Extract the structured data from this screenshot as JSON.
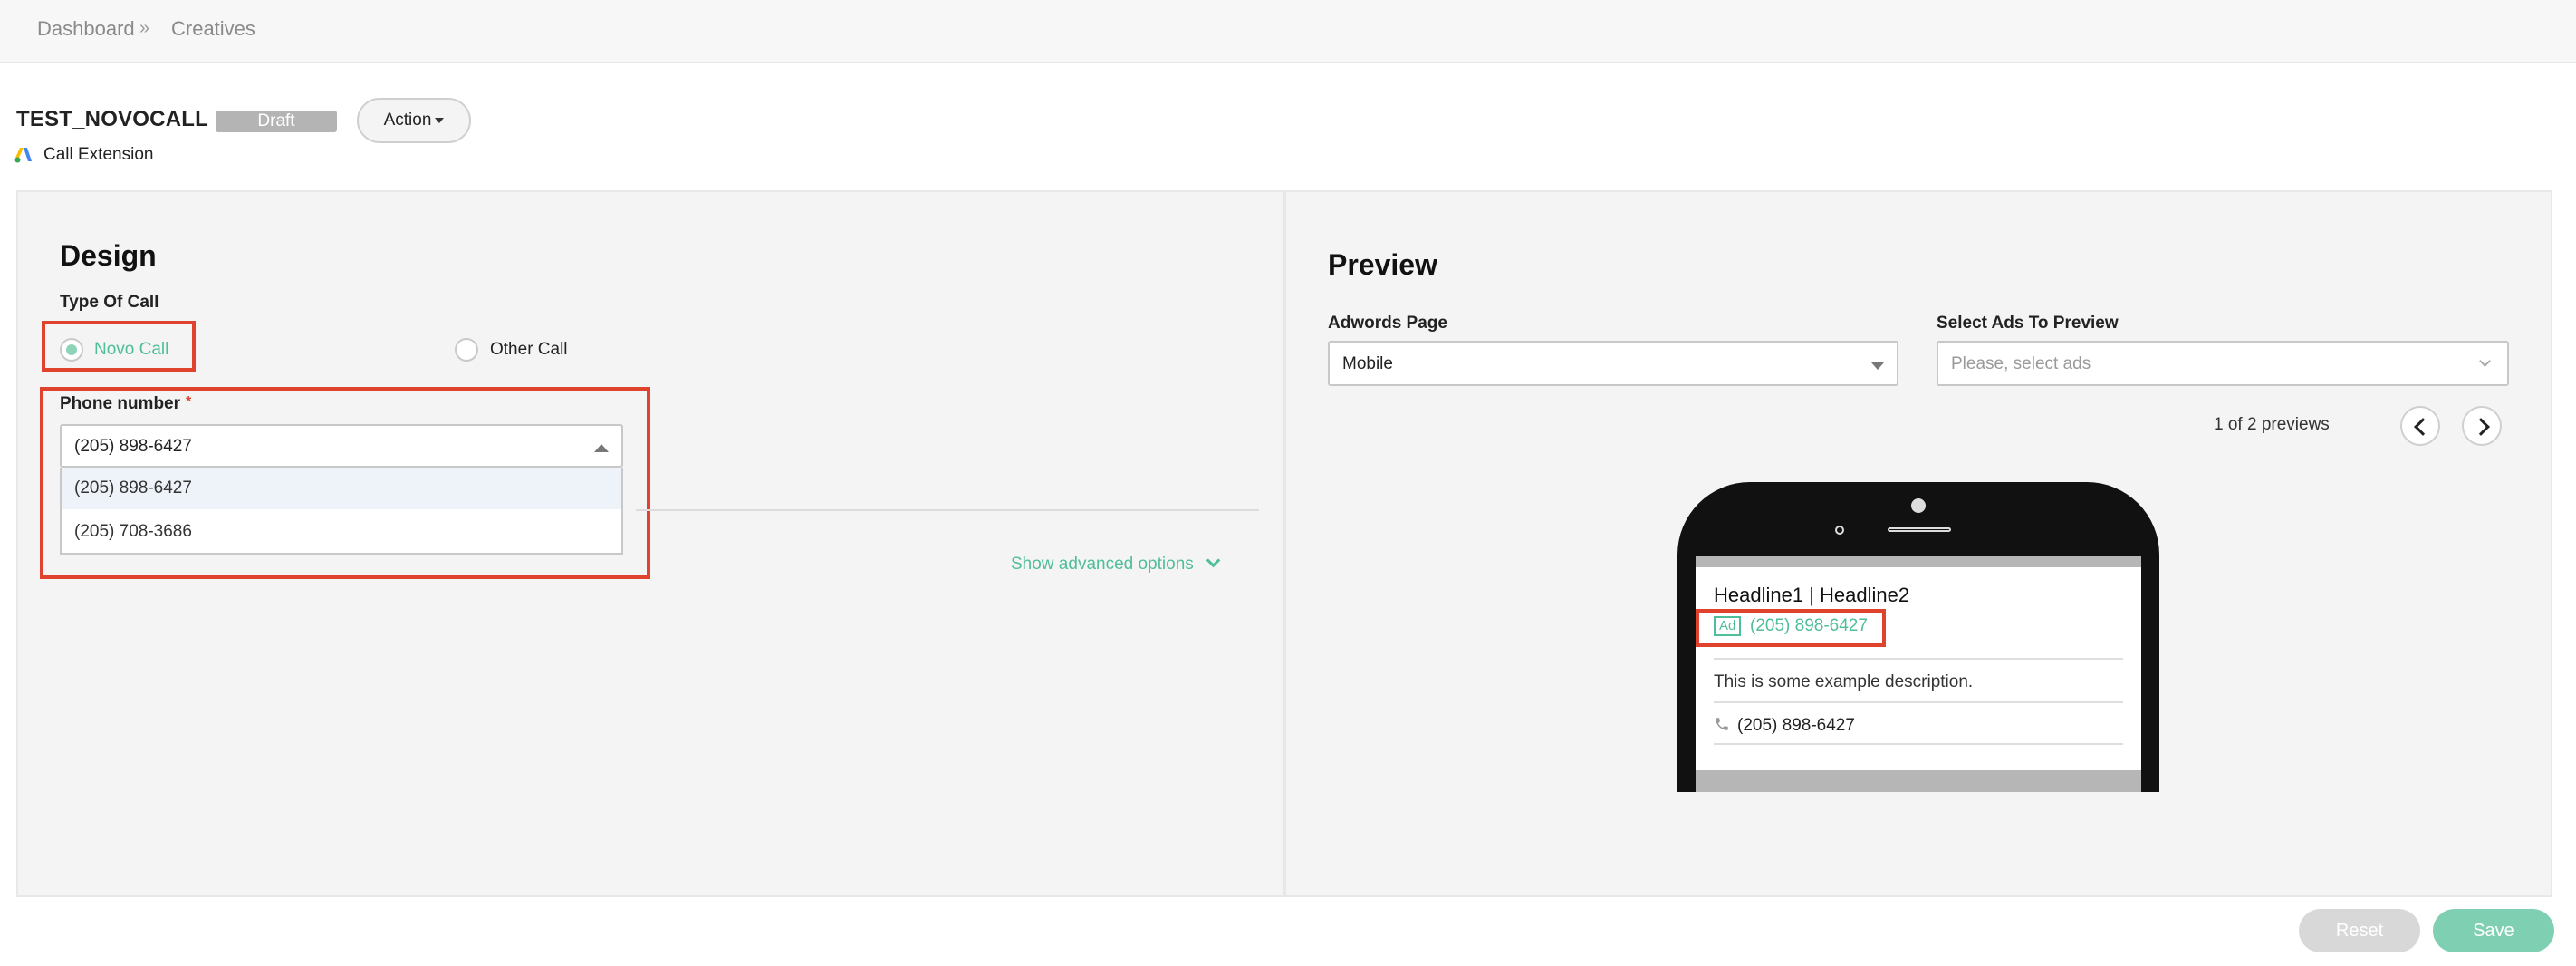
{
  "breadcrumb": {
    "items": [
      "Dashboard",
      "Creatives"
    ],
    "separator": "»"
  },
  "creative": {
    "name": "TEST_NOVOCALL",
    "status": "Draft",
    "action_label": "Action",
    "type": "Call Extension"
  },
  "design": {
    "heading": "Design",
    "type_of_call_label": "Type Of Call",
    "options": [
      {
        "label": "Novo Call",
        "checked": true
      },
      {
        "label": "Other Call",
        "checked": false
      }
    ],
    "phone_label": "Phone number",
    "required_mark": "*",
    "phone_value": "(205) 898-6427",
    "phone_options": [
      "(205) 898-6427",
      "(205) 708-3686"
    ],
    "advanced_label": "Show advanced options"
  },
  "preview": {
    "heading": "Preview",
    "page_label": "Adwords Page",
    "page_value": "Mobile",
    "ads_label": "Select Ads To Preview",
    "ads_placeholder": "Please, select ads",
    "counter": "1 of 2 previews",
    "ad": {
      "headline": "Headline1 | Headline2",
      "badge": "Ad",
      "phone": "(205) 898-6427",
      "description": "This is some example description.",
      "call_phone": "(205) 898-6427"
    }
  },
  "footer": {
    "reset_label": "Reset",
    "save_label": "Save"
  },
  "colors": {
    "accent": "#4fbe9a",
    "highlight": "#e0432d",
    "draft_badge": "#b4b4b4"
  }
}
